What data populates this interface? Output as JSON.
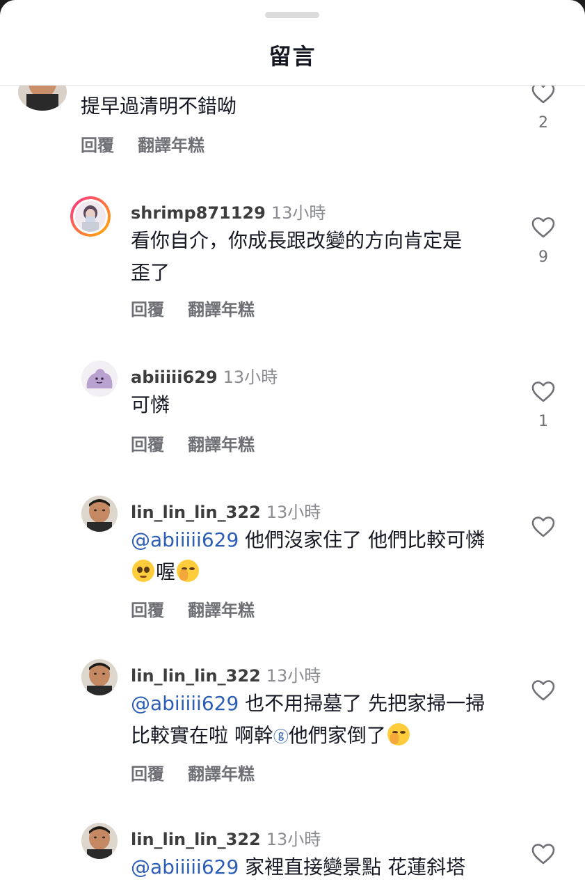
{
  "header": {
    "title": "留言"
  },
  "comments": [
    {
      "username": "",
      "time": "",
      "text": "提早過清明不錯呦",
      "reply": "回覆",
      "translate": "翻譯年糕",
      "likes": "2"
    },
    {
      "username": "shrimp871129",
      "time": "13小時",
      "text_line1": "看你自介，你成長跟改變的方向肯定是",
      "text_line2": "歪了",
      "reply": "回覆",
      "translate": "翻譯年糕",
      "likes": "9"
    },
    {
      "username": "abiiiii629",
      "time": "13小時",
      "text": "可憐",
      "reply": "回覆",
      "translate": "翻譯年糕",
      "likes": "1"
    },
    {
      "username": "lin_lin_lin_322",
      "time": "13小時",
      "mention": "@abiiiii629",
      "text_line1": " 他們沒家住了 他們比較可憐",
      "text_line2": "喔",
      "reply": "回覆",
      "translate": "翻譯年糕",
      "likes": ""
    },
    {
      "username": "lin_lin_lin_322",
      "time": "13小時",
      "mention": "@abiiiii629",
      "text_line1": " 也不用掃墓了 先把家掃一掃",
      "text_line2a": "比較實在啦 啊幹",
      "text_line2b": "他們家倒了",
      "reply": "回覆",
      "translate": "翻譯年糕",
      "likes": ""
    },
    {
      "username": "lin_lin_lin_322",
      "time": "13小時",
      "mention": "@abiiiii629",
      "text_line1": " 家裡直接變景點 花蓮斜塔",
      "likes": ""
    }
  ],
  "icons": {
    "like": "heart-outline-icon",
    "emoji_pleading": "pleading-face-icon",
    "emoji_shush": "shushing-face-icon",
    "mention_at": "at-sign-icon"
  },
  "colors": {
    "mention": "#2b5db5",
    "text": "#161823",
    "muted": "#8a8b91"
  }
}
